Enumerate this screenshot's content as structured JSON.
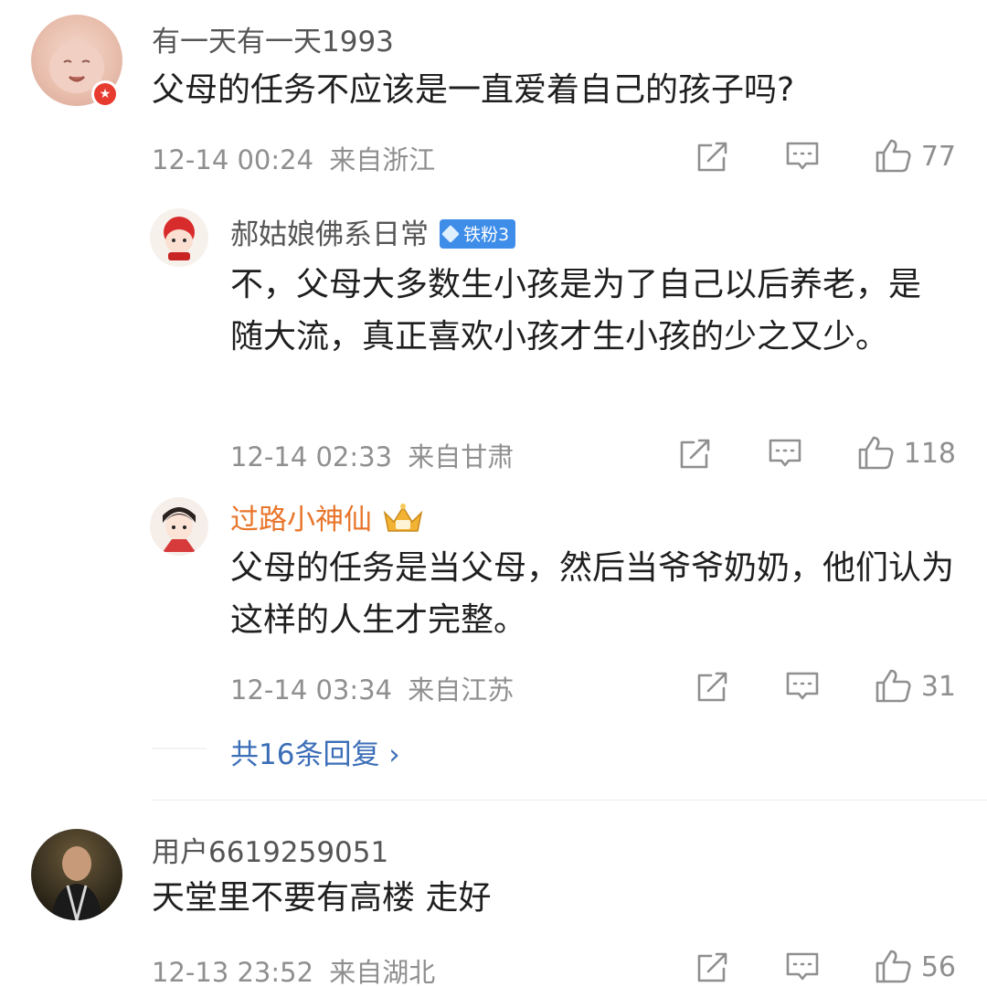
{
  "comments": [
    {
      "username": "有一天有一天1993",
      "text": "父母的任务不应该是一直爱着自己的孩子吗?",
      "time": "12-14 00:24",
      "location": "来自浙江",
      "likes": "77",
      "replies": [
        {
          "username": "郝姑娘佛系日常",
          "badge": "铁粉3",
          "text": "不，父母大多数生小孩是为了自己以后养老，是随大流，真正喜欢小孩才生小孩的少之又少。",
          "time": "12-14 02:33",
          "location": "来自甘肃",
          "likes": "118"
        },
        {
          "username": "过路小神仙",
          "text": "父母的任务是当父母，然后当爷爷奶奶，他们认为这样的人生才完整。",
          "time": "12-14 03:34",
          "location": "来自江苏",
          "likes": "31"
        }
      ],
      "more_replies": "共16条回复 ›"
    },
    {
      "username": "用户6619259051",
      "text": "天堂里不要有高楼 走好",
      "time": "12-13 23:52",
      "location": "来自湖北",
      "likes": "56"
    }
  ],
  "colors": {
    "reply_highlight_name": "#e8762c",
    "link_blue": "#3b6eb7",
    "meta_gray": "#8f8f8f",
    "fan_badge": "#3e8de9"
  },
  "icons": [
    "share-icon",
    "comment-icon",
    "like-icon",
    "vip-crown-icon",
    "fan-badge-gem-icon",
    "verified-badge-icon"
  ]
}
